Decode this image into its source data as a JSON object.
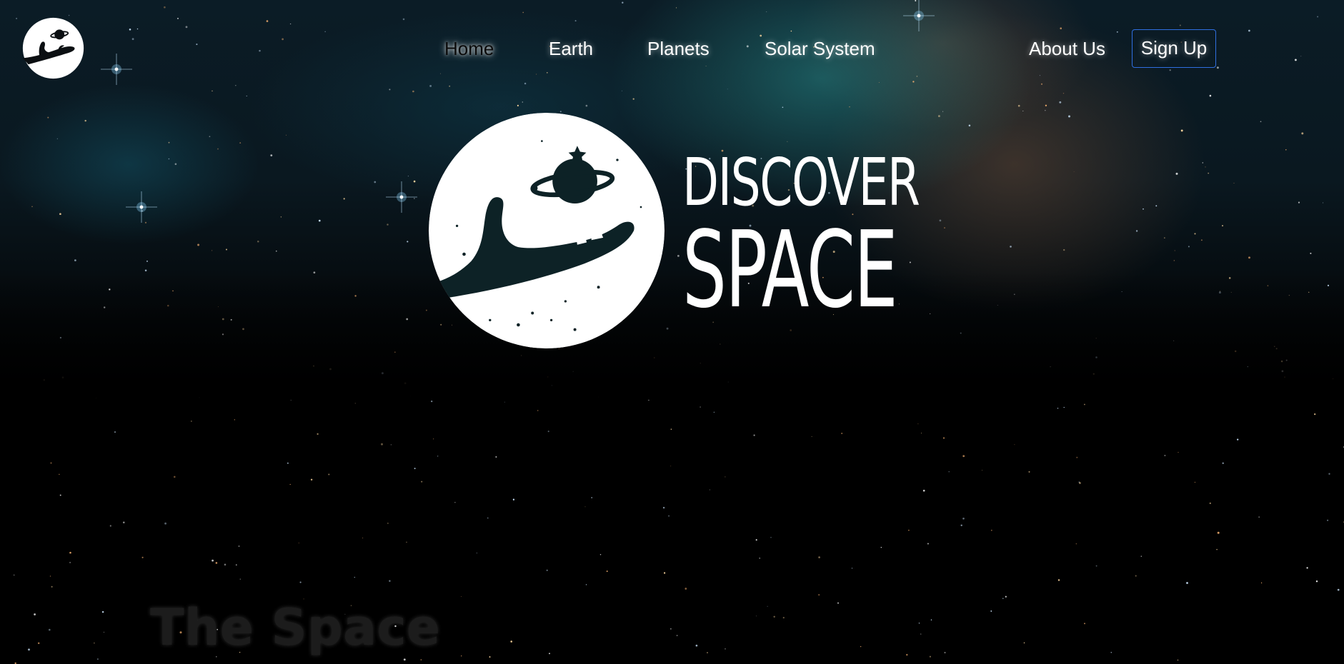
{
  "nav": {
    "logo_icon": "hand-holding-planet-icon",
    "links": [
      {
        "label": "Home",
        "active": true
      },
      {
        "label": "Earth",
        "active": false
      },
      {
        "label": "Planets",
        "active": false
      },
      {
        "label": "Solar System",
        "active": false
      },
      {
        "label": "About Us",
        "active": false
      }
    ],
    "signup_label": "Sign Up"
  },
  "hero": {
    "logo_icon": "hand-holding-planet-icon",
    "brand_line1": "DISCOVER",
    "brand_line2": "SPACE"
  },
  "section": {
    "title": "The Space"
  },
  "colors": {
    "signup_border": "#2f6fe0",
    "text": "#ffffff",
    "background": "#000000"
  }
}
